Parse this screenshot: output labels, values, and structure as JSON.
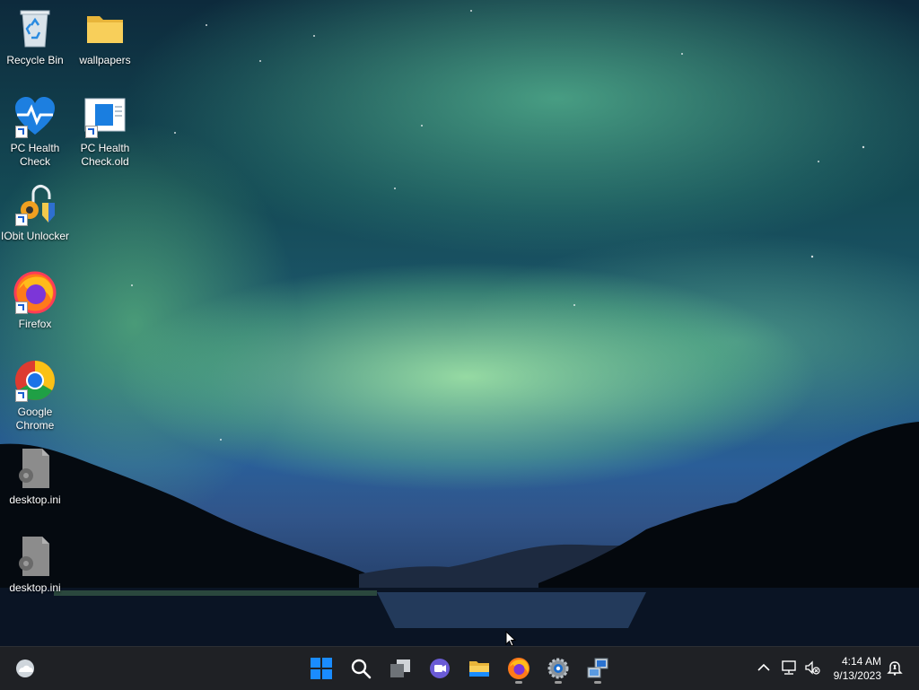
{
  "desktop": {
    "icons": [
      {
        "label": "Recycle Bin",
        "icon": "recycle-bin-icon"
      },
      {
        "label": "wallpapers",
        "icon": "folder-icon"
      },
      {
        "label": "PC Health Check",
        "icon": "pc-health-check-icon"
      },
      {
        "label": "PC Health Check.old",
        "icon": "pc-health-check-old-icon"
      },
      {
        "label": "IObit Unlocker",
        "icon": "iobit-unlocker-icon"
      },
      {
        "label": "Firefox",
        "icon": "firefox-icon"
      },
      {
        "label": "Google Chrome",
        "icon": "chrome-icon"
      },
      {
        "label": "desktop.ini",
        "icon": "settings-file-icon"
      },
      {
        "label": "desktop.ini",
        "icon": "settings-file-icon"
      }
    ]
  },
  "taskbar": {
    "weather_icon": "weather-cloud-icon",
    "pinned": [
      {
        "name": "start",
        "icon": "windows-start-icon"
      },
      {
        "name": "search",
        "icon": "search-icon"
      },
      {
        "name": "task-view",
        "icon": "task-view-icon"
      },
      {
        "name": "chat",
        "icon": "chat-icon"
      },
      {
        "name": "file-explorer",
        "icon": "folder-icon"
      },
      {
        "name": "firefox",
        "icon": "firefox-icon"
      },
      {
        "name": "settings",
        "icon": "gear-icon"
      },
      {
        "name": "app",
        "icon": "network-computer-icon"
      }
    ],
    "tray": {
      "chevron_icon": "chevron-up-icon",
      "network_icon": "network-icon",
      "volume_icon": "volume-muted-icon",
      "notification_icon": "notification-icon"
    },
    "clock": {
      "time": "4:14 AM",
      "date": "9/13/2023"
    }
  },
  "colors": {
    "taskbar_bg": "#1f2125",
    "accent_blue": "#1a8cff"
  }
}
